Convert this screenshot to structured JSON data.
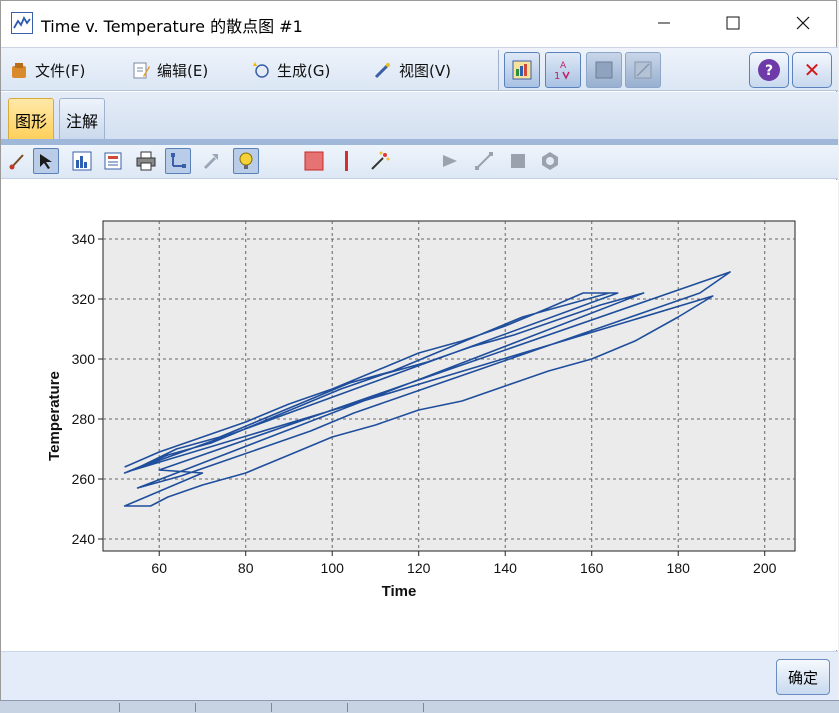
{
  "window": {
    "title": "Time v. Temperature 的散点图 #1"
  },
  "menu": {
    "file": "文件(F)",
    "edit": "编辑(E)",
    "generate": "生成(G)",
    "view": "视图(V)"
  },
  "tabs": {
    "graph": "图形",
    "annotation": "注解"
  },
  "buttons": {
    "ok": "确定",
    "help_glyph": "?",
    "close_glyph": "✕"
  },
  "colors": {
    "series": "#1f4e9c",
    "plot_bg": "#ebebeb",
    "active_tab": "#ffcf5a"
  },
  "chart_data": {
    "type": "line",
    "title": "",
    "xlabel": "Time",
    "ylabel": "Temperature",
    "xlim": [
      47,
      207
    ],
    "ylim": [
      236,
      346
    ],
    "xticks": [
      60,
      80,
      100,
      120,
      140,
      160,
      180,
      200
    ],
    "yticks": [
      240,
      260,
      280,
      300,
      320,
      340
    ],
    "grid": true,
    "series": [
      {
        "values": [
          [
            52,
            264
          ],
          [
            60,
            269
          ],
          [
            70,
            274
          ],
          [
            80,
            279
          ],
          [
            90,
            285
          ],
          [
            100,
            290
          ],
          [
            110,
            296
          ],
          [
            120,
            302
          ],
          [
            130,
            306
          ],
          [
            140,
            311
          ],
          [
            150,
            317
          ],
          [
            158,
            322
          ],
          [
            166,
            322
          ],
          [
            52,
            262
          ],
          [
            62,
            268
          ],
          [
            72,
            272
          ],
          [
            82,
            278
          ],
          [
            92,
            284
          ],
          [
            102,
            290
          ],
          [
            112,
            295
          ],
          [
            122,
            299
          ],
          [
            132,
            304
          ],
          [
            142,
            308
          ],
          [
            152,
            313
          ],
          [
            162,
            318
          ],
          [
            172,
            322
          ],
          [
            55,
            257
          ],
          [
            65,
            261
          ],
          [
            75,
            266
          ],
          [
            85,
            271
          ],
          [
            95,
            276
          ],
          [
            105,
            282
          ],
          [
            115,
            287
          ],
          [
            125,
            292
          ],
          [
            135,
            297
          ],
          [
            145,
            302
          ],
          [
            155,
            307
          ],
          [
            165,
            312
          ],
          [
            175,
            317
          ],
          [
            185,
            322
          ],
          [
            192,
            329
          ],
          [
            60,
            263
          ],
          [
            70,
            262
          ],
          [
            52,
            251
          ],
          [
            58,
            251
          ],
          [
            62,
            254
          ],
          [
            70,
            258
          ],
          [
            80,
            262
          ],
          [
            90,
            268
          ],
          [
            100,
            274
          ],
          [
            110,
            278
          ],
          [
            120,
            283
          ],
          [
            130,
            286
          ],
          [
            140,
            291
          ],
          [
            150,
            296
          ],
          [
            160,
            300
          ],
          [
            170,
            306
          ],
          [
            180,
            314
          ],
          [
            188,
            321
          ],
          [
            54,
            263
          ],
          [
            64,
            270
          ],
          [
            74,
            274
          ],
          [
            84,
            280
          ],
          [
            94,
            286
          ],
          [
            104,
            292
          ],
          [
            114,
            296
          ],
          [
            124,
            302
          ],
          [
            134,
            308
          ],
          [
            144,
            314
          ],
          [
            154,
            318
          ],
          [
            164,
            322
          ]
        ]
      }
    ]
  }
}
